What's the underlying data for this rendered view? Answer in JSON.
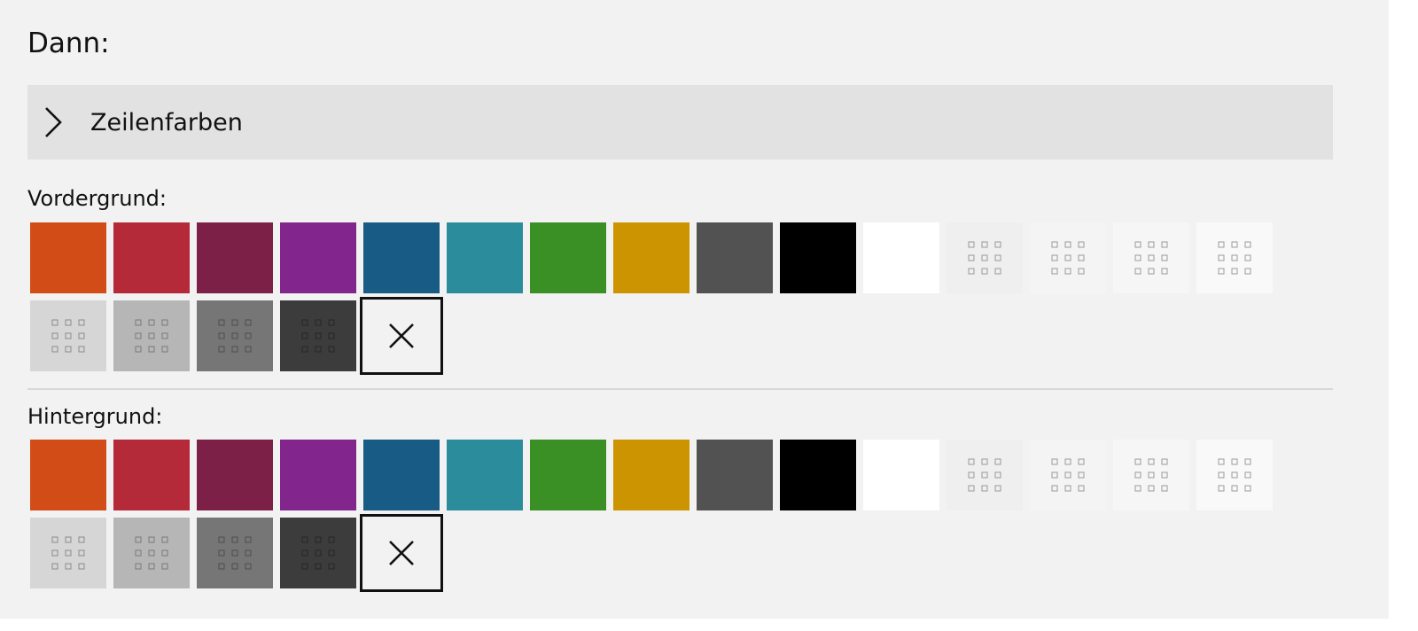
{
  "heading": "Dann:",
  "accordion": {
    "label": "Zeilenfarben",
    "icon": "chevron-right-icon"
  },
  "foreground": {
    "label": "Vordergrund:",
    "swatches": [
      {
        "name": "orange",
        "color": "#d14c17"
      },
      {
        "name": "red",
        "color": "#b42a39"
      },
      {
        "name": "maroon",
        "color": "#7d2047"
      },
      {
        "name": "purple",
        "color": "#82258c"
      },
      {
        "name": "blue",
        "color": "#185b85"
      },
      {
        "name": "teal",
        "color": "#2b8c9c"
      },
      {
        "name": "green",
        "color": "#3a8f25"
      },
      {
        "name": "gold",
        "color": "#cd9401"
      },
      {
        "name": "dark-gray",
        "color": "#525252"
      },
      {
        "name": "black",
        "color": "#000000"
      },
      {
        "name": "white",
        "color": "#ffffff"
      },
      {
        "name": "gray-1",
        "color": "#efefef",
        "pattern": "dots",
        "dot_color": "#9a9a9a"
      },
      {
        "name": "gray-2",
        "color": "#f4f4f4",
        "pattern": "dots",
        "dot_color": "#9a9a9a"
      },
      {
        "name": "gray-3",
        "color": "#f6f6f6",
        "pattern": "dots",
        "dot_color": "#9a9a9a"
      },
      {
        "name": "gray-4",
        "color": "#f9f9f9",
        "pattern": "dots",
        "dot_color": "#9a9a9a"
      },
      {
        "name": "gray-5",
        "color": "#d6d6d6",
        "pattern": "dots",
        "dot_color": "#8c8c8c"
      },
      {
        "name": "gray-6",
        "color": "#b6b6b6",
        "pattern": "dots",
        "dot_color": "#7a7a7a"
      },
      {
        "name": "gray-7",
        "color": "#767676",
        "pattern": "dots",
        "dot_color": "#4e4e4e"
      },
      {
        "name": "gray-8",
        "color": "#3c3c3c",
        "pattern": "dots",
        "dot_color": "#262626"
      },
      {
        "name": "clear",
        "type": "clear",
        "icon": "close-icon"
      }
    ]
  },
  "background": {
    "label": "Hintergrund:",
    "swatches": [
      {
        "name": "orange",
        "color": "#d14c17"
      },
      {
        "name": "red",
        "color": "#b42a39"
      },
      {
        "name": "maroon",
        "color": "#7d2047"
      },
      {
        "name": "purple",
        "color": "#82258c"
      },
      {
        "name": "blue",
        "color": "#185b85"
      },
      {
        "name": "teal",
        "color": "#2b8c9c"
      },
      {
        "name": "green",
        "color": "#3a8f25"
      },
      {
        "name": "gold",
        "color": "#cd9401"
      },
      {
        "name": "dark-gray",
        "color": "#525252"
      },
      {
        "name": "black",
        "color": "#000000"
      },
      {
        "name": "white",
        "color": "#ffffff"
      },
      {
        "name": "gray-1",
        "color": "#efefef",
        "pattern": "dots",
        "dot_color": "#9a9a9a"
      },
      {
        "name": "gray-2",
        "color": "#f4f4f4",
        "pattern": "dots",
        "dot_color": "#9a9a9a"
      },
      {
        "name": "gray-3",
        "color": "#f6f6f6",
        "pattern": "dots",
        "dot_color": "#9a9a9a"
      },
      {
        "name": "gray-4",
        "color": "#f9f9f9",
        "pattern": "dots",
        "dot_color": "#9a9a9a"
      },
      {
        "name": "gray-5",
        "color": "#d6d6d6",
        "pattern": "dots",
        "dot_color": "#8c8c8c"
      },
      {
        "name": "gray-6",
        "color": "#b6b6b6",
        "pattern": "dots",
        "dot_color": "#7a7a7a"
      },
      {
        "name": "gray-7",
        "color": "#767676",
        "pattern": "dots",
        "dot_color": "#4e4e4e"
      },
      {
        "name": "gray-8",
        "color": "#3c3c3c",
        "pattern": "dots",
        "dot_color": "#262626"
      },
      {
        "name": "clear",
        "type": "clear",
        "icon": "close-icon"
      }
    ]
  }
}
